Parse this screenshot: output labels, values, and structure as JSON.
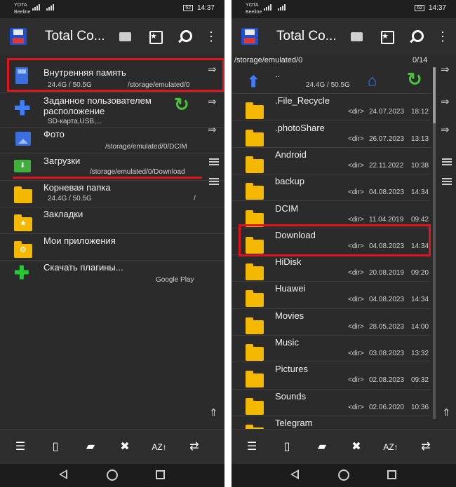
{
  "status": {
    "carrier1": "YOTA",
    "carrier2": "Beeline",
    "time": "14:37",
    "battery": "62"
  },
  "app": {
    "title": "Total Co..."
  },
  "left": {
    "items": [
      {
        "name": "Внутренняя память",
        "size": "24.4G / 50.5G",
        "path": "/storage/emulated/0"
      },
      {
        "name": "Заданное пользователем расположение",
        "sub": "SD-карта,USB,..."
      },
      {
        "name": "Фото",
        "path": "/storage/emulated/0/DCIM"
      },
      {
        "name": "Загрузки",
        "path": "/storage/emulated/0/Download"
      },
      {
        "name": "Корневая папка",
        "size": "24.4G / 50.5G",
        "path": "/"
      },
      {
        "name": "Закладки"
      },
      {
        "name": "Мои приложения"
      },
      {
        "name": "Скачать плагины...",
        "path": "Google Play"
      }
    ]
  },
  "right": {
    "path": "/storage/emulated/0",
    "count": "0/14",
    "up": {
      "name": "..",
      "size": "24.4G / 50.5G"
    },
    "files": [
      {
        "name": ".File_Recycle",
        "type": "<dir>",
        "date": "24.07.2023",
        "time": "18:12"
      },
      {
        "name": ".photoShare",
        "type": "<dir>",
        "date": "26.07.2023",
        "time": "13:13"
      },
      {
        "name": "Android",
        "type": "<dir>",
        "date": "22.11.2022",
        "time": "10:38"
      },
      {
        "name": "backup",
        "type": "<dir>",
        "date": "04.08.2023",
        "time": "14:34"
      },
      {
        "name": "DCIM",
        "type": "<dir>",
        "date": "11.04.2019",
        "time": "09:42"
      },
      {
        "name": "Download",
        "type": "<dir>",
        "date": "04.08.2023",
        "time": "14:34"
      },
      {
        "name": "HiDisk",
        "type": "<dir>",
        "date": "20.08.2019",
        "time": "09:20"
      },
      {
        "name": "Huawei",
        "type": "<dir>",
        "date": "04.08.2023",
        "time": "14:34"
      },
      {
        "name": "Movies",
        "type": "<dir>",
        "date": "28.05.2023",
        "time": "14:00"
      },
      {
        "name": "Music",
        "type": "<dir>",
        "date": "03.08.2023",
        "time": "13:32"
      },
      {
        "name": "Pictures",
        "type": "<dir>",
        "date": "02.08.2023",
        "time": "09:32"
      },
      {
        "name": "Sounds",
        "type": "<dir>",
        "date": "02.06.2020",
        "time": "10:36"
      },
      {
        "name": "Telegram"
      }
    ]
  },
  "icons": [
    "app-logo-icon",
    "folders-icon",
    "bookmark-icon",
    "search-icon",
    "menu-icon",
    "select-icon",
    "new-file-icon",
    "zip-icon",
    "delete-icon",
    "sort-icon",
    "swap-icon"
  ],
  "colors": {
    "highlight": "#e0141c",
    "folder": "#f5b800",
    "accent_blue": "#3d7dff",
    "accent_green": "#48c23a"
  }
}
